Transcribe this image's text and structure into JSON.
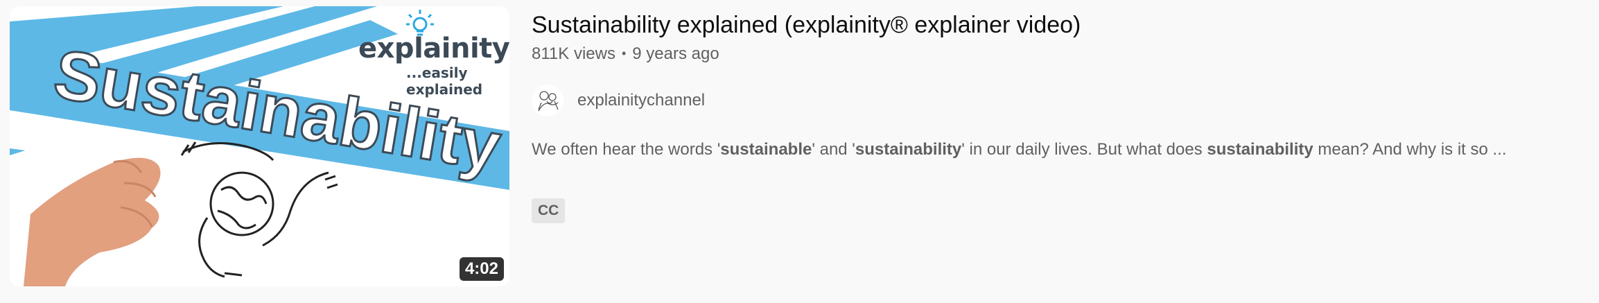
{
  "result": {
    "thumbnail": {
      "title_text": "Sustainability",
      "brand_name": "explainity",
      "brand_tagline": "...easily explained",
      "duration": "4:02",
      "colors": {
        "banner_blue": "#5db8e6",
        "brand_dark": "#3c4a57",
        "bulb_blue": "#29a9e1"
      }
    },
    "title": "Sustainability explained (explainity® explainer video)",
    "views": "811K views",
    "separator": "•",
    "age": "9 years ago",
    "channel": {
      "name": "explainitychannel",
      "avatar_icon": "sketch-avatar-icon"
    },
    "description": {
      "t1": "We often hear the words '",
      "b1": "sustainable",
      "t2": "' and '",
      "b2": "sustainability",
      "t3": "' in our daily lives. But what does ",
      "b3": "sustainability",
      "t4": " mean? And why is it so ..."
    },
    "badge": "CC"
  }
}
